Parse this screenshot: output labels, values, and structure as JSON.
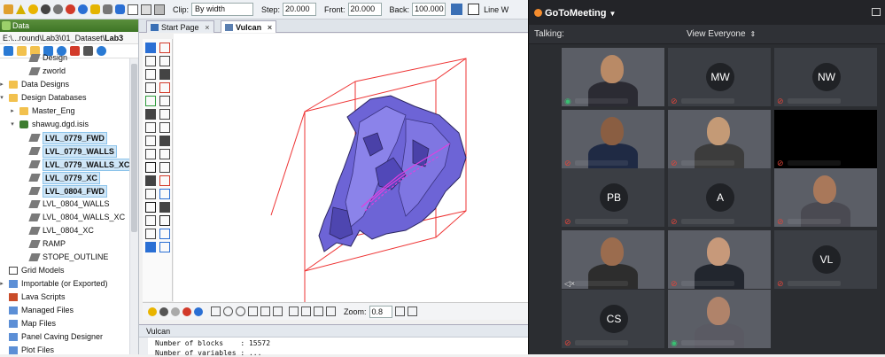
{
  "toolbar": {
    "clip_label": "Clip:",
    "clip_value": "By width",
    "step_label": "Step:",
    "step_value": "20.000",
    "front_label": "Front:",
    "front_value": "20.000",
    "back_label": "Back:",
    "back_value": "100.000",
    "line_label": "Line W"
  },
  "data_pane": {
    "title": "Data",
    "path_prefix": "E:\\...round\\Lab3\\01_Dataset\\",
    "path_bold": "Lab3",
    "tree": [
      {
        "label": "Design",
        "indent": 2,
        "icon": "layer",
        "selected": false
      },
      {
        "label": "zworld",
        "indent": 2,
        "icon": "layer",
        "selected": false
      },
      {
        "label": "Data Designs",
        "indent": 0,
        "icon": "folder",
        "selected": false
      },
      {
        "label": "Design Databases",
        "indent": 0,
        "icon": "folder",
        "selected": false
      },
      {
        "label": "Master_Eng",
        "indent": 1,
        "icon": "folder",
        "selected": false
      },
      {
        "label": "shawug.dgd.isis",
        "indent": 1,
        "icon": "db",
        "selected": false
      },
      {
        "label": "LVL_0779_FWD",
        "indent": 2,
        "icon": "layer",
        "selected": true
      },
      {
        "label": "LVL_0779_WALLS",
        "indent": 2,
        "icon": "layer",
        "selected": true
      },
      {
        "label": "LVL_0779_WALLS_XC",
        "indent": 2,
        "icon": "layer",
        "selected": true
      },
      {
        "label": "LVL_0779_XC",
        "indent": 2,
        "icon": "layer",
        "selected": true
      },
      {
        "label": "LVL_0804_FWD",
        "indent": 2,
        "icon": "layer",
        "selected": true
      },
      {
        "label": "LVL_0804_WALLS",
        "indent": 2,
        "icon": "layer",
        "selected": false
      },
      {
        "label": "LVL_0804_WALLS_XC",
        "indent": 2,
        "icon": "layer",
        "selected": false
      },
      {
        "label": "LVL_0804_XC",
        "indent": 2,
        "icon": "layer",
        "selected": false
      },
      {
        "label": "RAMP",
        "indent": 2,
        "icon": "layer",
        "selected": false
      },
      {
        "label": "STOPE_OUTLINE",
        "indent": 2,
        "icon": "layer",
        "selected": false
      },
      {
        "label": "Grid Models",
        "indent": 0,
        "icon": "grid",
        "selected": false
      },
      {
        "label": "Importable (or Exported)",
        "indent": 0,
        "icon": "file",
        "selected": false
      },
      {
        "label": "Lava Scripts",
        "indent": 0,
        "icon": "lava",
        "selected": false
      },
      {
        "label": "Managed Files",
        "indent": 0,
        "icon": "file",
        "selected": false
      },
      {
        "label": "Map Files",
        "indent": 0,
        "icon": "file",
        "selected": false
      },
      {
        "label": "Panel Caving Designer",
        "indent": 0,
        "icon": "file",
        "selected": false
      },
      {
        "label": "Plot Files",
        "indent": 0,
        "icon": "file",
        "selected": false
      }
    ]
  },
  "tabs": [
    {
      "label": "Start Page",
      "active": false
    },
    {
      "label": "Vulcan",
      "active": true
    }
  ],
  "bottom_tools": {
    "zoom_label": "Zoom:",
    "zoom_value": "0.8"
  },
  "output": {
    "title": "Vulcan",
    "line1": "Number of blocks    : 15572",
    "line2": "Number of variables : ..."
  },
  "meeting": {
    "app_name": "GoToMeeting",
    "talking_label": "Talking:",
    "view_label": "View Everyone",
    "colors": {
      "muted": "#e0453a",
      "live": "#38c172",
      "brand": "#f68d2e"
    },
    "tiles": [
      {
        "type": "video",
        "initials": "",
        "mic": "live"
      },
      {
        "type": "avatar",
        "initials": "MW",
        "mic": "muted"
      },
      {
        "type": "avatar",
        "initials": "NW",
        "mic": "muted"
      },
      {
        "type": "video",
        "initials": "",
        "mic": "muted"
      },
      {
        "type": "video",
        "initials": "",
        "mic": "muted"
      },
      {
        "type": "black",
        "initials": "",
        "mic": "muted"
      },
      {
        "type": "avatar",
        "initials": "PB",
        "mic": "muted"
      },
      {
        "type": "avatar",
        "initials": "A",
        "mic": "muted"
      },
      {
        "type": "video",
        "initials": "",
        "mic": "muted"
      },
      {
        "type": "video",
        "initials": "",
        "mic": "off"
      },
      {
        "type": "video",
        "initials": "",
        "mic": "muted"
      },
      {
        "type": "avatar",
        "initials": "VL",
        "mic": "muted"
      },
      {
        "type": "avatar",
        "initials": "CS",
        "mic": "muted"
      },
      {
        "type": "video",
        "initials": "",
        "mic": "live"
      }
    ]
  }
}
